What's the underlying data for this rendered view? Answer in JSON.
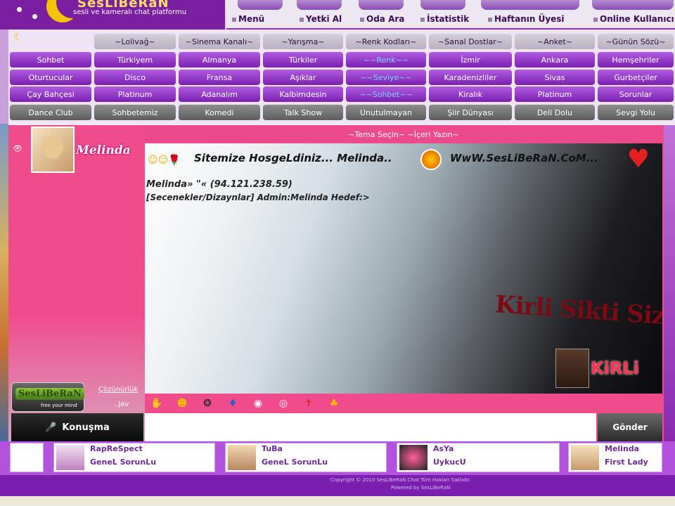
{
  "logo": {
    "text": "SesLiBeRaN",
    "tagline": "sesli ve kameralı chat platformu"
  },
  "topnav": [
    "Menü",
    "Yetki Al",
    "Oda Ara",
    "İstatistik",
    "Haftanın Üyesi",
    "Online Kullanıcı"
  ],
  "menu": {
    "headers": [
      "~Lolivağ~",
      "~Sinema Kanalı~",
      "~Yarışma~",
      "~Renk Kodları~",
      "~Sanal Dostlar~",
      "~Anket~",
      "~Günün Sözü~"
    ],
    "rows": [
      [
        "Sohbet",
        "Türkiyem",
        "Almanya",
        "Türkiler",
        "",
        "İzmir",
        "Ankara",
        "Hemşehriler"
      ],
      [
        "Oturtucular",
        "Disco",
        "Fransa",
        "Aşıklar",
        "",
        "Karadenizliler",
        "Sivas",
        "Gurbetçiler"
      ],
      [
        "Çay Bahçesi",
        "Platinum",
        "Adanalım",
        "Kalbimdesin",
        "",
        "Kiralık",
        "Platinum",
        "Sorunlar"
      ],
      [
        "Dance Club",
        "Sohbetemiz",
        "Komedi",
        "Talk Show",
        "Unutulmayan",
        "Şiir Dünyası",
        "Deli Dolu",
        "Sevgi Yolu"
      ]
    ],
    "color_links": [
      "~~Renk~~",
      "~~Seviye~~",
      "~~Sohbet~~"
    ]
  },
  "chat": {
    "title": "~Tema Seçin~ ~İçeri Yazın~",
    "user_name": "Melinda",
    "welcome": "Sitemize HosgeLdiniz... Melinda..",
    "site_url": "WwW.SesLiBeRaN.CoM...",
    "ip_line": "Melinda» \"« (94.121.238.59)",
    "status_line": "[Secenekler/Dizaynlar] Admin:Melinda Hedef:>",
    "graffiti": "Kirli Sikti Sizi",
    "kirli_logo": "KiRLi"
  },
  "left_panel": {
    "badge": "SesLiBeRaN",
    "badge_sub": "free your mind",
    "resolution_link": "Çözünürlük",
    "resolution_sub": "..Jav"
  },
  "input": {
    "konusma_label": "Konuşma",
    "send_label": "Gönder",
    "placeholder": ""
  },
  "online_users": [
    {
      "name": "RapReSpect",
      "status": "GeneL SorunLu"
    },
    {
      "name": "TuBa",
      "status": "GeneL SorunLu"
    },
    {
      "name": "AsYa",
      "status": "UykucU"
    },
    {
      "name": "Melinda",
      "status": "First Lady"
    }
  ],
  "footer": {
    "line1": "Copyright © 2010 SesLiBeRaN Chat Tüm Hakları Saklıdır.",
    "line2": "Powered by SesLiBeRaN"
  }
}
